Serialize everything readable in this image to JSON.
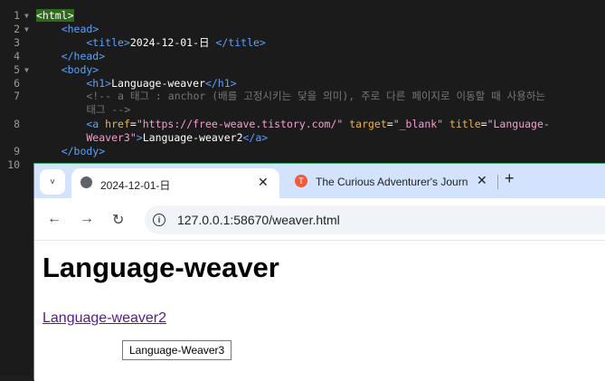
{
  "editor": {
    "lines": [
      {
        "num": "1",
        "fold": "▼",
        "segments": [
          {
            "text": "<html>",
            "cls": "hl-html"
          }
        ]
      },
      {
        "num": "2",
        "fold": "▼",
        "segments": [
          {
            "text": "    <head>",
            "cls": "tg"
          }
        ]
      },
      {
        "num": "3",
        "fold": "",
        "segments": [
          {
            "text": "        <title>",
            "cls": "tg"
          },
          {
            "text": "2024-12-01-日",
            "cls": "wt"
          },
          {
            "text": " </title>",
            "cls": "tg"
          }
        ]
      },
      {
        "num": "4",
        "fold": "",
        "segments": [
          {
            "text": "    </head>",
            "cls": "tg"
          }
        ]
      },
      {
        "num": "5",
        "fold": "▼",
        "segments": [
          {
            "text": "    <body>",
            "cls": "tg"
          }
        ]
      },
      {
        "num": "6",
        "fold": "",
        "segments": [
          {
            "text": "        <h1>",
            "cls": "tg"
          },
          {
            "text": "Language-weaver",
            "cls": "wt"
          },
          {
            "text": "</h1>",
            "cls": "tg"
          }
        ]
      },
      {
        "num": "7",
        "fold": "",
        "segments": [
          {
            "text": "        <!-- a 태그 : anchor (배를 고정시키는 닻을 의미), 주로 다른 페이지로 이동할 때 사용하는",
            "cls": "cm"
          }
        ]
      },
      {
        "num": "",
        "fold": "",
        "segments": [
          {
            "text": "        태그 -->",
            "cls": "cm"
          }
        ]
      },
      {
        "num": "8",
        "fold": "",
        "segments": [
          {
            "text": "        <a ",
            "cls": "tg"
          },
          {
            "text": "href",
            "cls": "at"
          },
          {
            "text": "=",
            "cls": "wt"
          },
          {
            "text": "\"https://free-weave.tistory.com/\"",
            "cls": "vl"
          },
          {
            "text": " target",
            "cls": "at"
          },
          {
            "text": "=",
            "cls": "wt"
          },
          {
            "text": "\"_blank\"",
            "cls": "vl"
          },
          {
            "text": " title",
            "cls": "at"
          },
          {
            "text": "=",
            "cls": "wt"
          },
          {
            "text": "\"Language-",
            "cls": "vl"
          }
        ]
      },
      {
        "num": "",
        "fold": "",
        "segments": [
          {
            "text": "        Weaver3\"",
            "cls": "vl"
          },
          {
            "text": ">",
            "cls": "tg"
          },
          {
            "text": "Language-weaver2",
            "cls": "wt"
          },
          {
            "text": "</a>",
            "cls": "tg"
          }
        ]
      },
      {
        "num": "9",
        "fold": "",
        "segments": [
          {
            "text": "    </body>",
            "cls": "tg"
          }
        ]
      },
      {
        "num": "10",
        "fold": "",
        "segments": [
          {
            "text": "",
            "cls": "wt"
          }
        ]
      }
    ]
  },
  "browser": {
    "tabs": [
      {
        "title": "2024-12-01-日",
        "active": true
      },
      {
        "title": "The Curious Adventurer's Journ",
        "active": false
      }
    ],
    "tab_menu_icon": "˅",
    "close_icon": "✕",
    "new_tab_icon": "+",
    "favicon_letter": "T",
    "nav": {
      "back": "←",
      "forward": "→",
      "reload": "↻"
    },
    "info_icon": "i",
    "url": "127.0.0.1:58670/weaver.html"
  },
  "page": {
    "heading": "Language-weaver",
    "link_text": "Language-weaver2",
    "tooltip": "Language-Weaver3"
  }
}
